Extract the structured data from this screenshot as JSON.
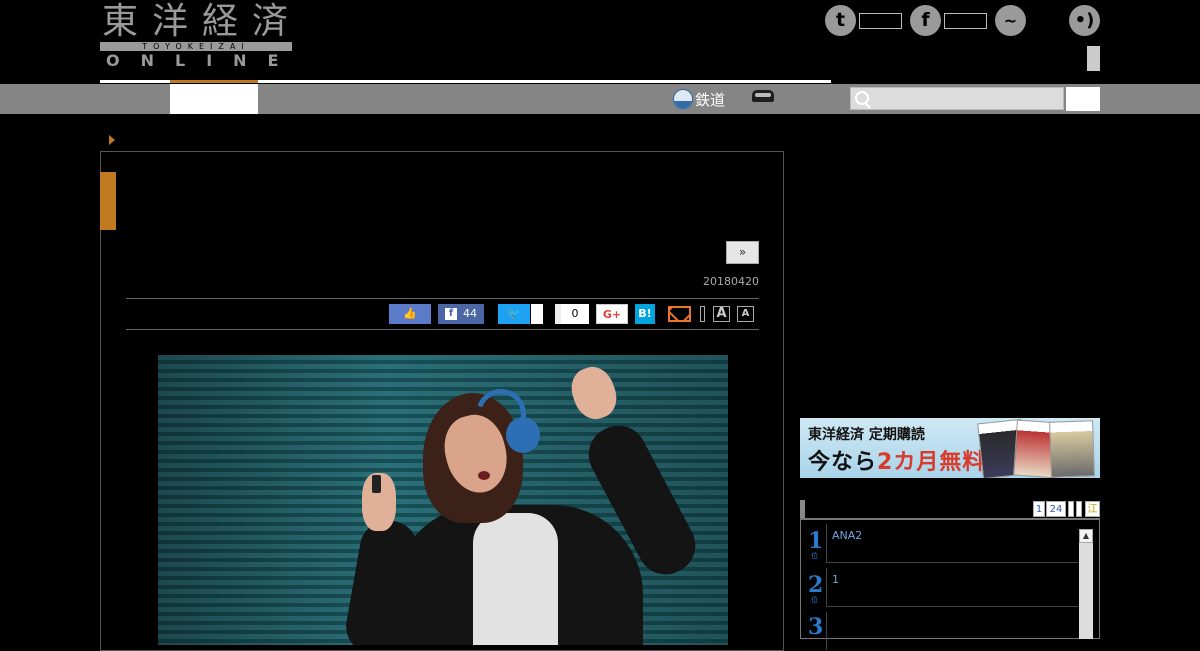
{
  "logo": {
    "kanji": "東洋経済",
    "romaji": "TOYOKEIZAI",
    "online": "ONLINE"
  },
  "social": {
    "twitter_glyph": "t",
    "facebook_glyph": "f",
    "messenger_glyph": "~",
    "rss_glyph": "•)"
  },
  "nav": {
    "rail_label": "鉄道"
  },
  "article": {
    "next_label": "»",
    "date": "20180420",
    "share": {
      "like_glyph": "👍",
      "facebook_count": "44",
      "facebook_glyph": "f",
      "twitter_glyph": "🐦",
      "pocket_count": "0",
      "gplus_label": "G+",
      "hatena_label": "B!",
      "font_large": "A",
      "font_small": "A"
    }
  },
  "ad": {
    "brand": "東洋経済",
    "line1_suffix": " 定期購読",
    "line2_prefix": "今なら",
    "line2_highlight": "2カ月無料"
  },
  "ranking": {
    "tabs": [
      "1",
      "24"
    ],
    "tab_extra": "江",
    "items": [
      {
        "rank": "1",
        "title": "ANA2"
      },
      {
        "rank": "2",
        "title": "1"
      },
      {
        "rank": "3",
        "title": ""
      }
    ],
    "scroll_up": "▲"
  }
}
